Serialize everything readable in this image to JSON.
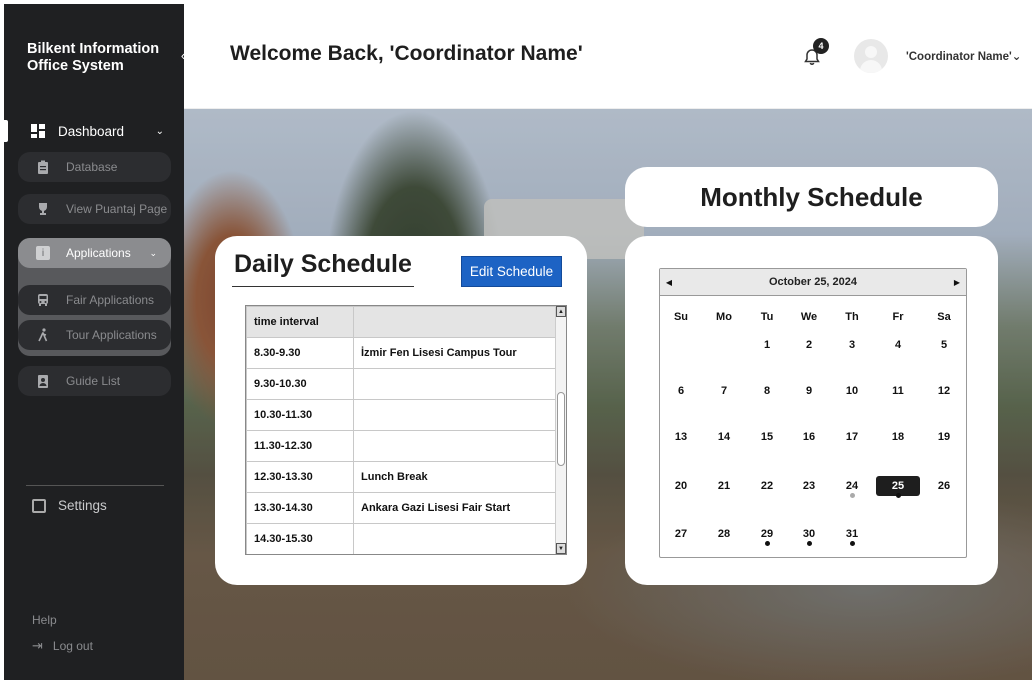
{
  "sidebar": {
    "brand": "Bilkent Information Office System",
    "collapse_icon": "chevron-left-icon",
    "dashboard_label": "Dashboard",
    "items": [
      {
        "label": "Database",
        "icon": "clipboard-icon"
      },
      {
        "label": "View Puantaj Page",
        "icon": "trophy-icon"
      },
      {
        "label": "Applications",
        "icon": "info-icon"
      },
      {
        "label": "Fair Applications",
        "icon": "bus-icon"
      },
      {
        "label": "Tour Applications",
        "icon": "walking-icon"
      },
      {
        "label": "Guide List",
        "icon": "id-badge-icon"
      }
    ],
    "settings_label": "Settings",
    "help_label": "Help",
    "logout_label": "Log out"
  },
  "header": {
    "welcome": "Welcome Back, 'Coordinator Name'",
    "notification_count": "4",
    "user_name": "'Coordinator Name'"
  },
  "daily": {
    "title": "Daily Schedule",
    "edit_button": "Edit Schedule",
    "columns": [
      "time interval",
      ""
    ],
    "rows": [
      [
        "8.30-9.30",
        "İzmir Fen Lisesi Campus Tour"
      ],
      [
        "9.30-10.30",
        ""
      ],
      [
        "10.30-11.30",
        ""
      ],
      [
        "11.30-12.30",
        ""
      ],
      [
        "12.30-13.30",
        "Lunch Break"
      ],
      [
        "13.30-14.30",
        "Ankara Gazi Lisesi Fair Start"
      ],
      [
        "14.30-15.30",
        ""
      ]
    ]
  },
  "monthly": {
    "title": "Monthly Schedule",
    "month_label": "October 25, 2024",
    "weekdays": [
      "Su",
      "Mo",
      "Tu",
      "We",
      "Th",
      "Fr",
      "Sa"
    ],
    "days": [
      [
        "",
        "",
        "1",
        "2",
        "3",
        "4",
        "5"
      ],
      [
        "6",
        "7",
        "8",
        "9",
        "10",
        "11",
        "12"
      ],
      [
        "13",
        "14",
        "15",
        "16",
        "17",
        "18",
        "19"
      ],
      [
        "20",
        "21",
        "22",
        "23",
        "24",
        "25",
        "26"
      ],
      [
        "27",
        "28",
        "29",
        "30",
        "31",
        "",
        ""
      ]
    ],
    "selected_day": "25",
    "event_days": [
      "24",
      "25",
      "29",
      "30",
      "31"
    ]
  },
  "colors": {
    "sidebar_bg": "#1f2022",
    "accent_button": "#1d63c4",
    "selected_day_bg": "#1e1e1e"
  }
}
